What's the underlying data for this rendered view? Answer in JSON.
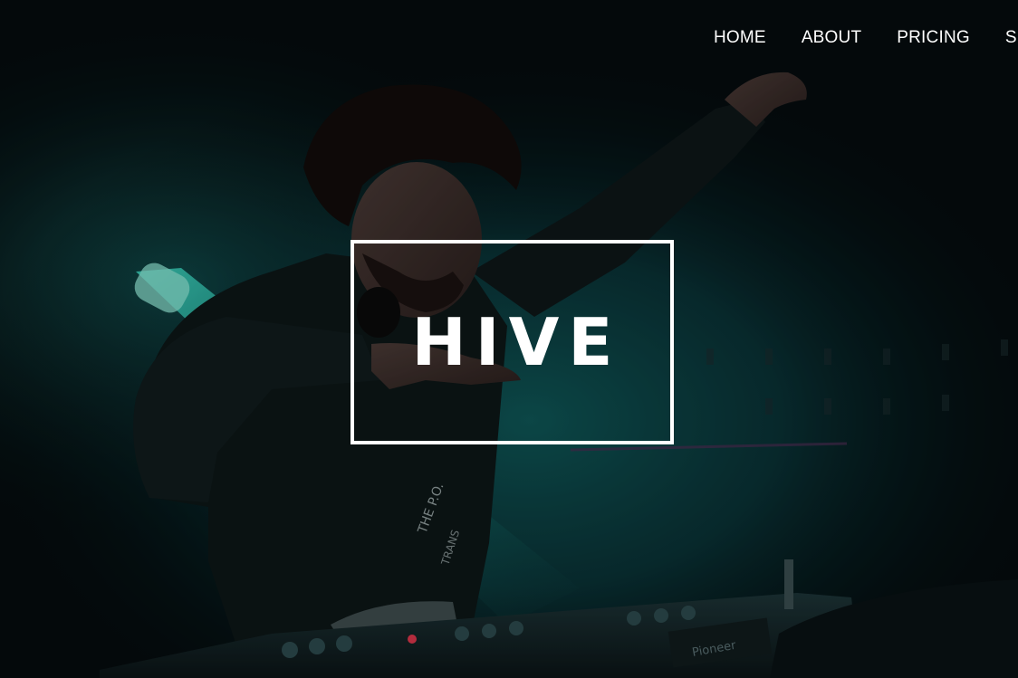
{
  "nav": {
    "items": [
      {
        "label": "HOME"
      },
      {
        "label": "ABOUT"
      },
      {
        "label": "PRICING"
      },
      {
        "label": "SERVICES"
      }
    ]
  },
  "hero": {
    "logo_text": "HIVE",
    "image_description": ""
  },
  "colors": {
    "nav_text": "#ffffff",
    "logo_border": "#ffffff",
    "accent_teal": "#1fb8a8",
    "background": "#04090b"
  }
}
